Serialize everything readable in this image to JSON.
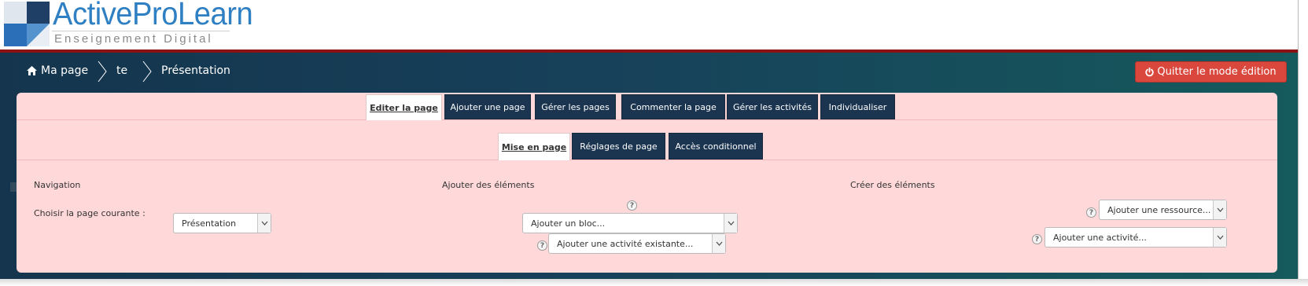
{
  "logo": {
    "title": "ActiveProLearn",
    "subtitle": "Enseignement Digital",
    "icon": "logo-squares-icon"
  },
  "breadcrumb": {
    "home_icon": "home-icon",
    "items": [
      "Ma page",
      "te",
      "Présentation"
    ],
    "separator_icon": "chevron-right-icon"
  },
  "quit_button": {
    "icon": "power-icon",
    "label": "Quitter le mode édition",
    "color": "#d9473d"
  },
  "main_tabs": [
    {
      "label": "Editer la page",
      "active": true
    },
    {
      "label": "Ajouter une page",
      "active": false
    },
    {
      "label": "Gérer les pages",
      "active": false
    },
    {
      "label": "Commenter la page",
      "active": false
    },
    {
      "label": "Gérer les activités",
      "active": false
    },
    {
      "label": "Individualiser",
      "active": false
    }
  ],
  "sub_tabs": [
    {
      "label": "Mise en page",
      "active": true
    },
    {
      "label": "Réglages de page",
      "active": false
    },
    {
      "label": "Accès conditionnel",
      "active": false
    }
  ],
  "sections": {
    "navigation": "Navigation",
    "add_elements": "Ajouter des éléments",
    "create_elements": "Créer des éléments"
  },
  "navigation": {
    "label": "Choisir la page courante :",
    "selected": "Présentation"
  },
  "add_elements": {
    "block_select": "Ajouter un bloc...",
    "existing_activity_select": "Ajouter une activité existante..."
  },
  "create_elements": {
    "resource_select": "Ajouter une ressource...",
    "activity_select": "Ajouter une activité..."
  },
  "help_glyph": "?",
  "colors": {
    "header_bg": "#17405a",
    "panel_bg": "#ffd9da",
    "tab_bg": "#1b3550",
    "accent_red": "#d9473d",
    "logo_blue": "#2f7fc3"
  }
}
